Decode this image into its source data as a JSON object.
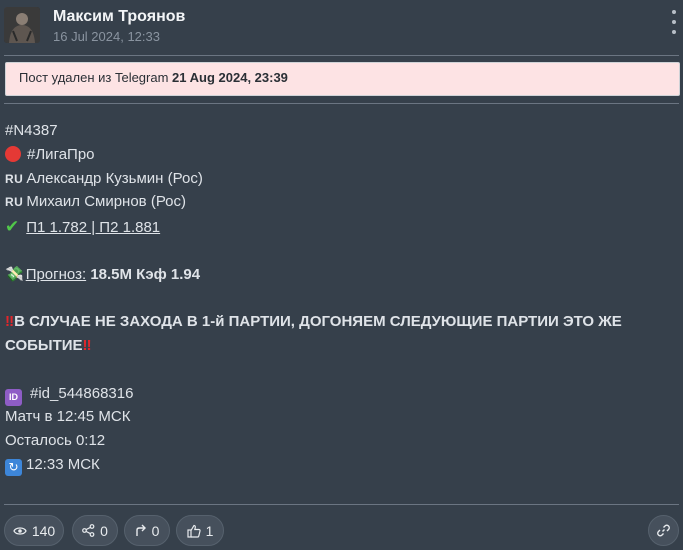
{
  "post": {
    "author": "Максим Троянов",
    "date": "16 Jul 2024, 12:33",
    "deleted_prefix": "Пост удален из Telegram ",
    "deleted_date": "21 Aug 2024, 23:39"
  },
  "content": {
    "hashtag_id": "#N4387",
    "league_tag": "#ЛигаПро",
    "player1_flag": "RU",
    "player1": "Александр Кузьмин (Рос)",
    "player2_flag": "RU",
    "player2": "Михаил Смирнов (Рос)",
    "odds": "П1 1.782 | П2 1.881",
    "forecast_label": "Прогноз:",
    "forecast_value": "18.5M Кэф 1.94",
    "warning_line1": "В СЛУЧАЕ НЕ ЗАХОДА В 1-й ПАРТИИ, ДОГОНЯЕМ СЛЕДУЮЩИЕ ПАРТИИ ЭТО ЖЕ",
    "warning_line2": "СОБЫТИЕ",
    "id_emoji": "ID",
    "id_tag": "#id_544868316",
    "match_time": "Матч в 12:45 МСК",
    "remaining": "Осталось 0:12",
    "updated_time": "12:33 МСК"
  },
  "footer": {
    "views": "140",
    "shares": "0",
    "forwards": "0",
    "likes": "1"
  },
  "colors": {
    "background": "#36404b",
    "banner_bg": "#fde3e4",
    "accent_red": "#e0262b",
    "check_green": "#51c84a"
  },
  "icons": {
    "menu": "vertical-dots-icon",
    "views": "eye-icon",
    "shares": "share-icon",
    "forwards": "forward-arrow-icon",
    "likes": "thumbs-up-icon",
    "link": "link-icon"
  }
}
